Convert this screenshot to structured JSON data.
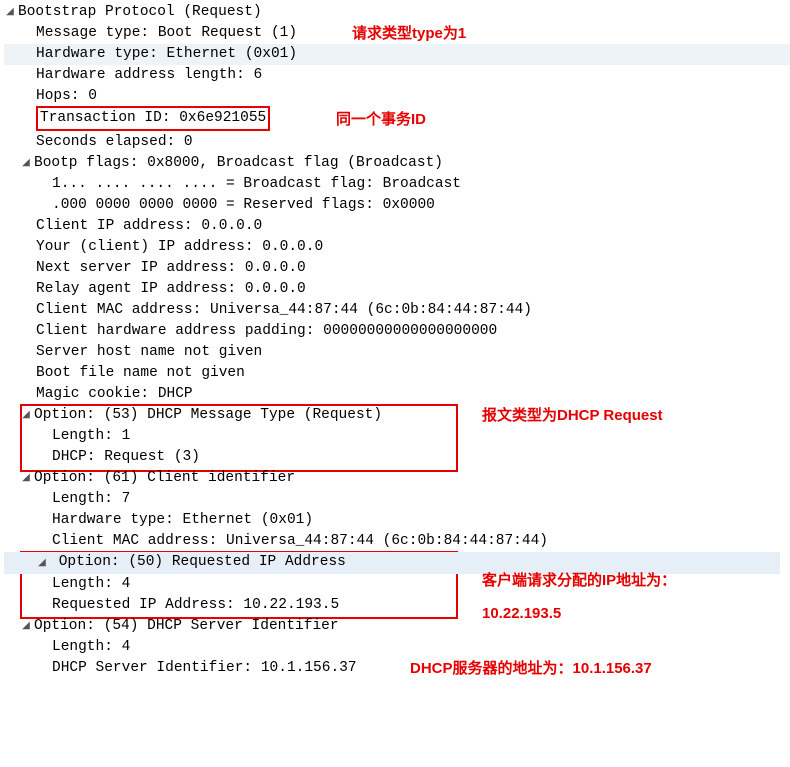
{
  "root": {
    "label": "Bootstrap Protocol (Request)"
  },
  "msg_type": {
    "label": "Message type: Boot Request (1)"
  },
  "hw_type": {
    "label": "Hardware type: Ethernet (0x01)"
  },
  "hw_len": {
    "label": "Hardware address length: 6"
  },
  "hops": {
    "label": "Hops: 0"
  },
  "txid": {
    "label": "Transaction ID: 0x6e921055"
  },
  "secs": {
    "label": "Seconds elapsed: 0"
  },
  "flags": {
    "label": "Bootp flags: 0x8000, Broadcast flag (Broadcast)"
  },
  "flag_bc": {
    "label": "1... .... .... .... = Broadcast flag: Broadcast"
  },
  "flag_res": {
    "label": ".000 0000 0000 0000 = Reserved flags: 0x0000"
  },
  "ciaddr": {
    "label": "Client IP address: 0.0.0.0"
  },
  "yiaddr": {
    "label": "Your (client) IP address: 0.0.0.0"
  },
  "siaddr": {
    "label": "Next server IP address: 0.0.0.0"
  },
  "giaddr": {
    "label": "Relay agent IP address: 0.0.0.0"
  },
  "chaddr": {
    "label": "Client MAC address: Universa_44:87:44 (6c:0b:84:44:87:44)"
  },
  "chpad": {
    "label": "Client hardware address padding: 00000000000000000000"
  },
  "sname": {
    "label": "Server host name not given"
  },
  "bfile": {
    "label": "Boot file name not given"
  },
  "cookie": {
    "label": "Magic cookie: DHCP"
  },
  "opt53": {
    "label": "Option: (53) DHCP Message Type (Request)"
  },
  "opt53_len": {
    "label": "Length: 1"
  },
  "opt53_val": {
    "label": "DHCP: Request (3)"
  },
  "opt61": {
    "label": "Option: (61) Client identifier"
  },
  "opt61_len": {
    "label": "Length: 7"
  },
  "opt61_hw": {
    "label": "Hardware type: Ethernet (0x01)"
  },
  "opt61_mac": {
    "label": "Client MAC address: Universa_44:87:44 (6c:0b:84:44:87:44)"
  },
  "opt50": {
    "label": "Option: (50) Requested IP Address"
  },
  "opt50_len": {
    "label": "Length: 4"
  },
  "opt50_val": {
    "label": "Requested IP Address: 10.22.193.5"
  },
  "opt54": {
    "label": "Option: (54) DHCP Server Identifier"
  },
  "opt54_len": {
    "label": "Length: 4"
  },
  "opt54_val": {
    "label": "DHCP Server Identifier: 10.1.156.37"
  },
  "anno": {
    "type1": "请求类型type为1",
    "txid": "同一个事务ID",
    "req": "报文类型为DHCP Request",
    "req_ip1": "客户端请求分配的IP地址为：",
    "req_ip2": "10.22.193.5",
    "server": "DHCP服务器的地址为：10.1.156.37"
  }
}
